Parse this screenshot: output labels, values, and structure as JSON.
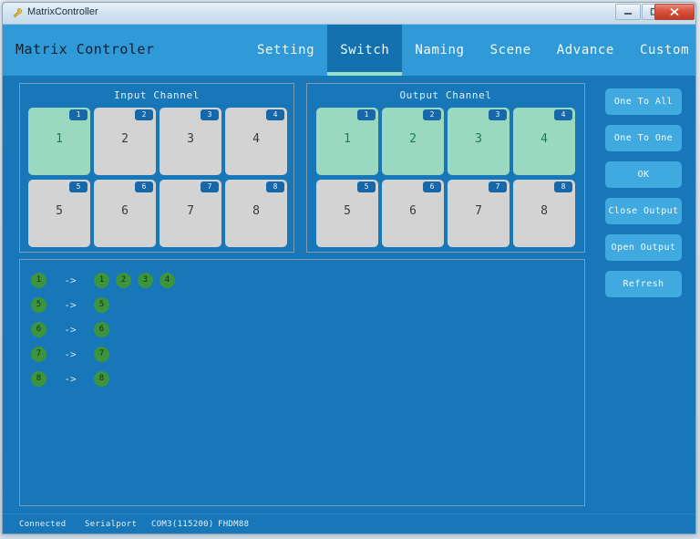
{
  "window": {
    "title": "MatrixController",
    "app_icon": "key-icon",
    "controls": {
      "minimize": "minimize-icon",
      "maximize": "maximize-icon",
      "close": "close-icon"
    }
  },
  "header": {
    "title": "Matrix Controler",
    "tabs": [
      {
        "label": "Setting",
        "active": false
      },
      {
        "label": "Switch",
        "active": true
      },
      {
        "label": "Naming",
        "active": false
      },
      {
        "label": "Scene",
        "active": false
      },
      {
        "label": "Advance",
        "active": false
      },
      {
        "label": "Custom",
        "active": false
      }
    ]
  },
  "input_panel": {
    "title": "Input Channel",
    "tiles": [
      {
        "label": "1",
        "badge": "1",
        "selected": true
      },
      {
        "label": "2",
        "badge": "2",
        "selected": false
      },
      {
        "label": "3",
        "badge": "3",
        "selected": false
      },
      {
        "label": "4",
        "badge": "4",
        "selected": false
      },
      {
        "label": "5",
        "badge": "5",
        "selected": false
      },
      {
        "label": "6",
        "badge": "6",
        "selected": false
      },
      {
        "label": "7",
        "badge": "7",
        "selected": false
      },
      {
        "label": "8",
        "badge": "8",
        "selected": false
      }
    ]
  },
  "output_panel": {
    "title": "Output Channel",
    "tiles": [
      {
        "label": "1",
        "badge": "1",
        "selected": true
      },
      {
        "label": "2",
        "badge": "2",
        "selected": true
      },
      {
        "label": "3",
        "badge": "3",
        "selected": true
      },
      {
        "label": "4",
        "badge": "4",
        "selected": true
      },
      {
        "label": "5",
        "badge": "5",
        "selected": false
      },
      {
        "label": "6",
        "badge": "6",
        "selected": false
      },
      {
        "label": "7",
        "badge": "7",
        "selected": false
      },
      {
        "label": "8",
        "badge": "8",
        "selected": false
      }
    ]
  },
  "routing_panel": {
    "arrow": "->",
    "rows": [
      {
        "source": "1",
        "targets": [
          "1",
          "2",
          "3",
          "4"
        ]
      },
      {
        "source": "5",
        "targets": [
          "5"
        ]
      },
      {
        "source": "6",
        "targets": [
          "6"
        ]
      },
      {
        "source": "7",
        "targets": [
          "7"
        ]
      },
      {
        "source": "8",
        "targets": [
          "8"
        ]
      }
    ]
  },
  "side_buttons": [
    {
      "label": "One To All"
    },
    {
      "label": "One To One"
    },
    {
      "label": "OK"
    },
    {
      "label": "Close Output"
    },
    {
      "label": "Open Output"
    },
    {
      "label": "Refresh"
    }
  ],
  "status_bar": {
    "connection": "Connected",
    "interface": "Serialport",
    "port": "COM3(115200)",
    "model": "FHDM88"
  },
  "colors": {
    "header_blue": "#309ad8",
    "active_tab_blue": "#1471b0",
    "body_blue": "#1877b8",
    "tile_selected_green": "#9ad9bf",
    "tile_unselected_grey": "#d3d3d3",
    "badge_blue": "#1668a8",
    "button_blue": "#40a9e0",
    "route_dot_green": "#3c943c",
    "tab_underline_green": "#9bdcc4"
  }
}
